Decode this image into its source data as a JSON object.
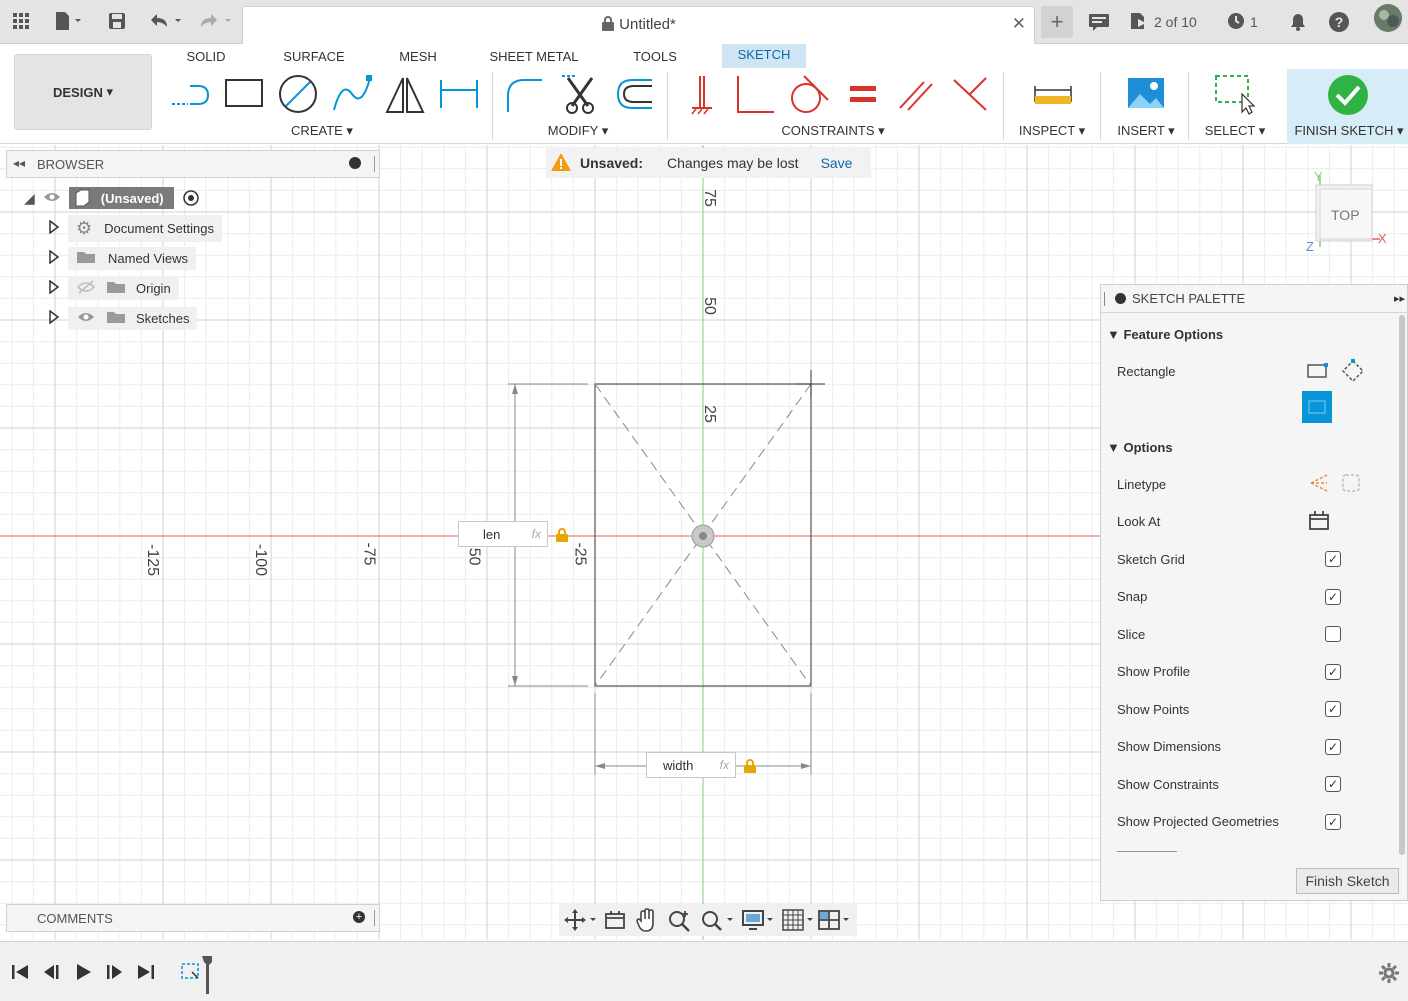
{
  "titlebar": {
    "doc_title": "Untitled*",
    "jobs_count": "2 of 10",
    "clock_count": "1",
    "help": "?"
  },
  "ribbon": {
    "tabs": [
      "SOLID",
      "SURFACE",
      "MESH",
      "SHEET METAL",
      "TOOLS",
      "SKETCH"
    ],
    "active_tab": "SKETCH",
    "workspace": "DESIGN",
    "groups": {
      "create": "CREATE",
      "modify": "MODIFY",
      "constraints": "CONSTRAINTS",
      "inspect": "INSPECT",
      "insert": "INSERT",
      "select": "SELECT",
      "finish": "FINISH SKETCH"
    }
  },
  "browser": {
    "title": "BROWSER",
    "root": "(Unsaved)",
    "items": [
      "Document Settings",
      "Named Views",
      "Origin",
      "Sketches"
    ]
  },
  "banner": {
    "label": "Unsaved:",
    "message": "Changes may be lost",
    "action": "Save"
  },
  "viewcube": {
    "face": "TOP",
    "x_axis": "X",
    "y_axis": "Y",
    "z_axis": "Z"
  },
  "canvas": {
    "axis_labels_v": [
      "75",
      "50",
      "25",
      "-25"
    ],
    "axis_labels_h": [
      "-125",
      "-100",
      "-75",
      "-50"
    ],
    "dim_len": "len",
    "dim_width": "width",
    "fx": "fx"
  },
  "palette": {
    "title": "SKETCH PALETTE",
    "feature_options": "Feature Options",
    "rectangle": "Rectangle",
    "options": "Options",
    "rows": [
      {
        "label": "Linetype",
        "kind": "icon"
      },
      {
        "label": "Look At",
        "kind": "icon"
      },
      {
        "label": "Sketch Grid",
        "checked": true
      },
      {
        "label": "Snap",
        "checked": true
      },
      {
        "label": "Slice",
        "checked": false
      },
      {
        "label": "Show Profile",
        "checked": true
      },
      {
        "label": "Show Points",
        "checked": true
      },
      {
        "label": "Show Dimensions",
        "checked": true
      },
      {
        "label": "Show Constraints",
        "checked": true
      },
      {
        "label": "Show Projected Geometries",
        "checked": true
      }
    ],
    "finish_button": "Finish Sketch"
  },
  "comments": {
    "title": "COMMENTS"
  },
  "colors": {
    "accent": "#0696d7",
    "ribbon_active": "#cfe5f3",
    "finish_green": "#2fb344",
    "constraint_red": "#d9322b",
    "axis_red": "#e06060",
    "axis_green": "#7fd07f"
  }
}
